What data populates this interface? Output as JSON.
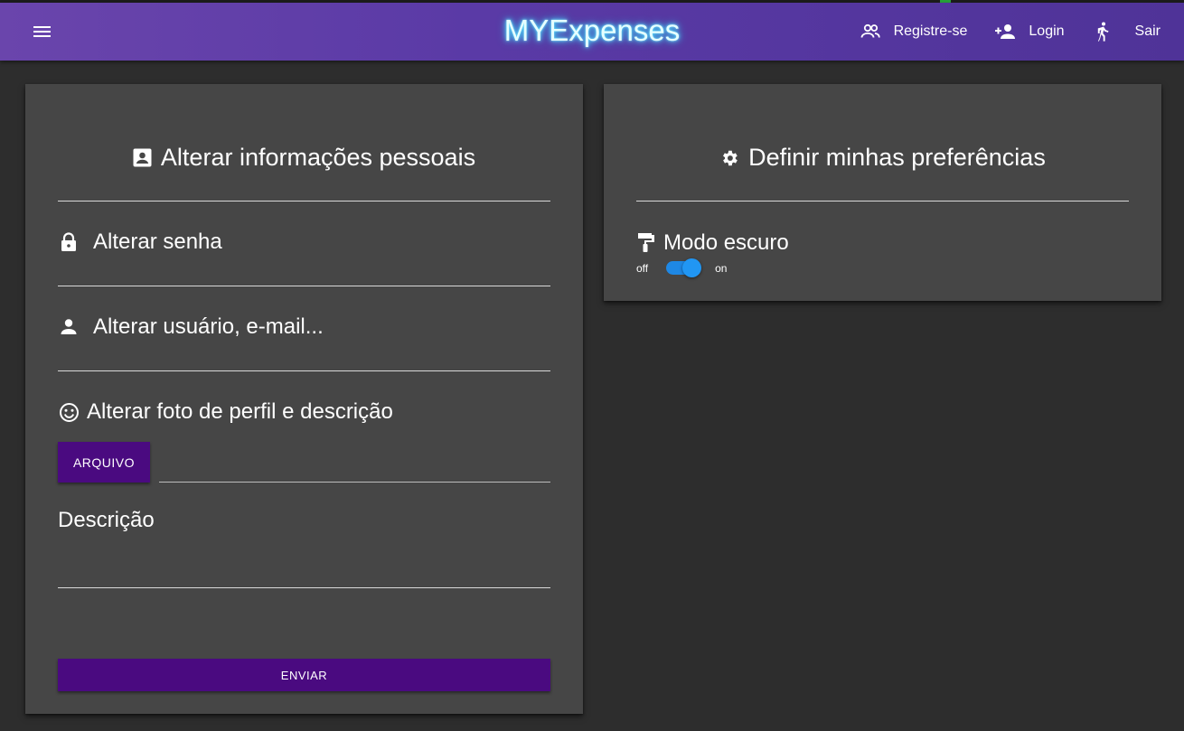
{
  "navbar": {
    "menu_icon": "hamburger-menu-icon",
    "brand": "MYExpenses",
    "links": [
      {
        "label": "Registre-se",
        "icon": "people-icon"
      },
      {
        "label": "Login",
        "icon": "person-add-icon"
      },
      {
        "label": "Sair",
        "icon": "walking-person-icon"
      }
    ]
  },
  "personal": {
    "title": "Alterar informações pessoais",
    "title_icon": "account-box-icon",
    "change_password": "Alterar senha",
    "change_password_icon": "lock-icon",
    "change_user": "Alterar usuário, e-mail...",
    "change_user_icon": "person-icon",
    "change_photo": "Alterar foto de perfil e descrição",
    "change_photo_icon": "smiley-face-icon",
    "file_button": "ARQUIVO",
    "file_path_value": "",
    "description_label": "Descrição",
    "description_value": "",
    "submit_button": "ENVIAR"
  },
  "preferences": {
    "title": "Definir minhas preferências",
    "title_icon": "gear-icon",
    "dark_mode_label": "Modo escuro",
    "dark_mode_icon": "paint-roller-icon",
    "switch_off_label": "off",
    "switch_on_label": "on",
    "dark_mode_on": true
  },
  "colors": {
    "navbar_start": "#6a45ac",
    "navbar_end": "#4f3398",
    "background": "#2d2d2d",
    "card": "#464646",
    "button": "#4a0a80",
    "switch": "#2196f3",
    "brand_glow": "#4fe3ff"
  }
}
